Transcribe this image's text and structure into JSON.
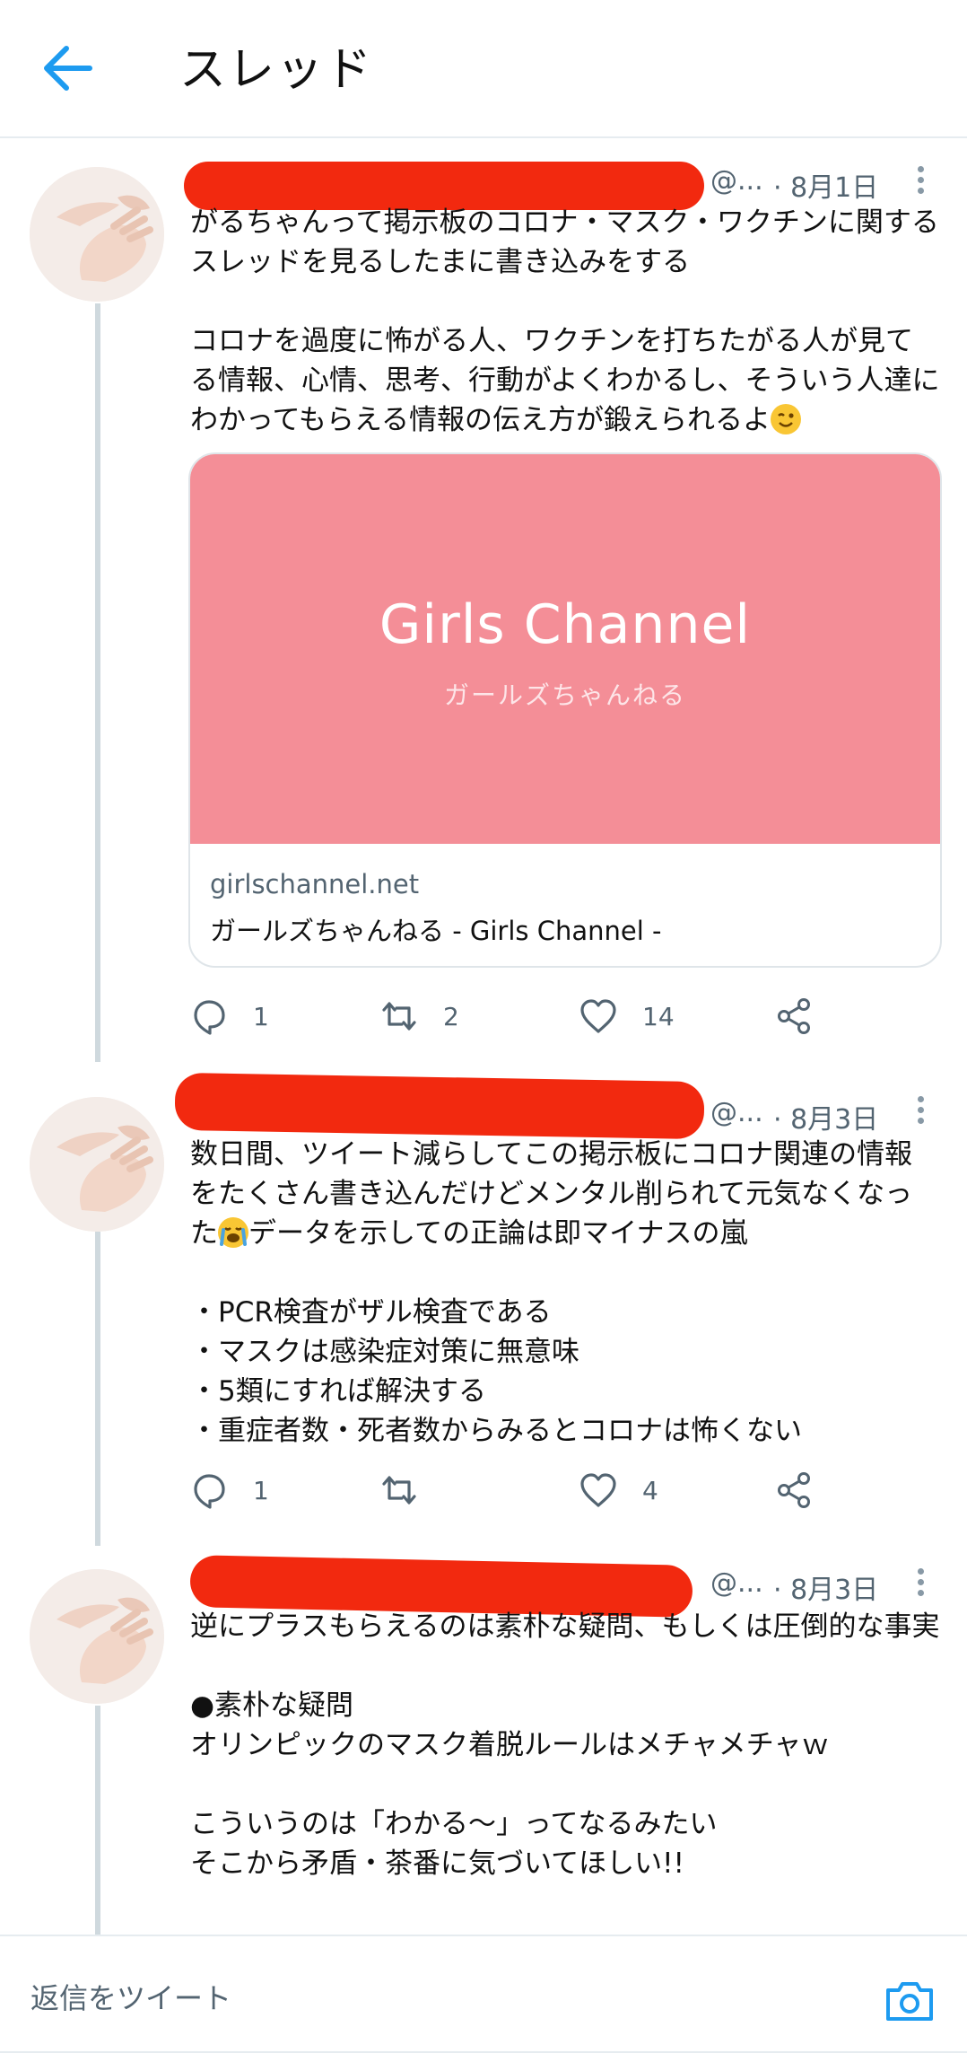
{
  "header": {
    "title": "スレッド",
    "back_icon": "arrow-left-icon",
    "accent": "#1d9bf0"
  },
  "tweets": [
    {
      "handle": "@...",
      "date": "· 8月1日",
      "text_pre": "がるちゃんって掲示板のコロナ・マスク・ワクチンに関するスレッドを見るしたまに書き込みをする\n\nコロナを過度に怖がる人、ワクチンを打ちたがる人が見てる情報、心情、思考、行動がよくわかるし、そういう人達にわかってもらえる情報の伝え方が鍛えられるよ",
      "emoji": "winking-face",
      "text_post": "",
      "card": {
        "brand": "Girls Channel",
        "brand_sub": "ガールズちゃんねる",
        "domain": "girlschannel.net",
        "title": "ガールズちゃんねる - Girls Channel -",
        "color": "#f48e97"
      },
      "replies": "1",
      "retweets": "2",
      "likes": "14"
    },
    {
      "handle": "@...",
      "date": "· 8月3日",
      "text_pre": "数日間、ツイート減らしてこの掲示板にコロナ関連の情報をたくさん書き込んだけどメンタル削られて元気なくなった",
      "emoji": "loudly-crying-face",
      "text_post": "データを示しての正論は即マイナスの嵐\n\n・PCR検査がザル検査である\n・マスクは感染症対策に無意味\n・5類にすれば解決する\n・重症者数・死者数からみるとコロナは怖くない",
      "replies": "1",
      "retweets": "",
      "likes": "4"
    },
    {
      "handle": "@...",
      "date": "· 8月3日",
      "text_pre": "逆にプラスもらえるのは素朴な疑問、もしくは圧倒的な事実\n\n●素朴な疑問\nオリンピックのマスク着脱ルールはメチャメチャｗ\n\nこういうのは「わかる～」ってなるみたい\nそこから矛盾・茶番に気づいてほしい!!",
      "emoji": "",
      "text_post": ""
    }
  ],
  "reply_bar": {
    "placeholder": "返信をツイート",
    "camera_icon": "camera-icon"
  },
  "colors": {
    "redaction": "#f2290f",
    "thread_line": "#cfd9de",
    "muted": "#536471"
  }
}
